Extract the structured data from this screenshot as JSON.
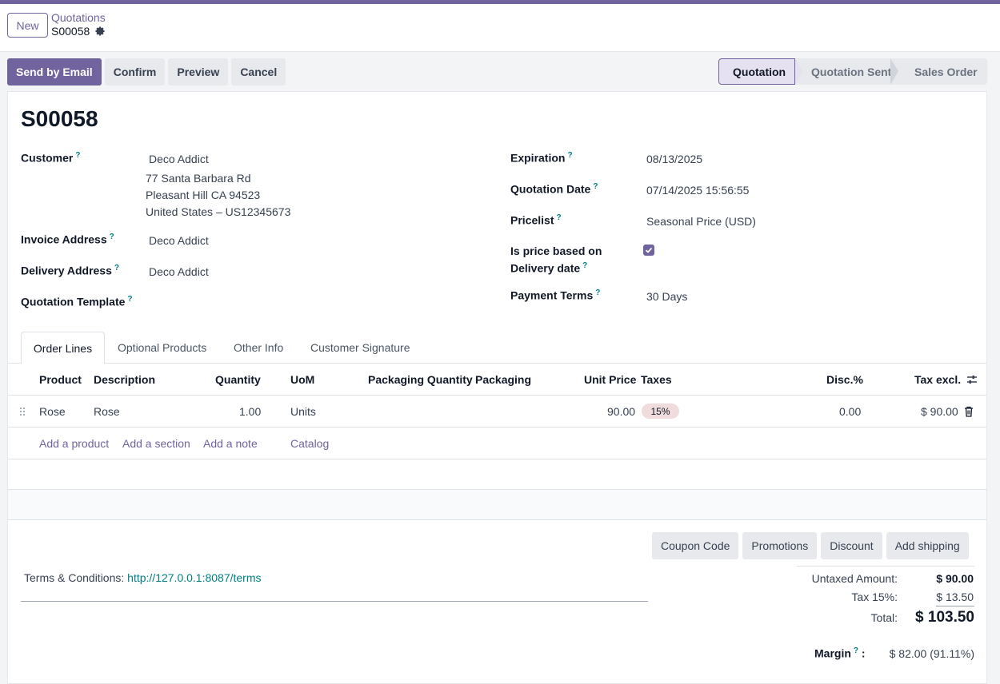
{
  "header": {
    "new_label": "New",
    "breadcrumb_parent": "Quotations",
    "breadcrumb_current": "S00058"
  },
  "actions": {
    "send_email": "Send by Email",
    "confirm": "Confirm",
    "preview": "Preview",
    "cancel": "Cancel"
  },
  "status": {
    "quotation": "Quotation",
    "quotation_sent": "Quotation Sent",
    "sales_order": "Sales Order",
    "active": "Quotation"
  },
  "form": {
    "title": "S00058",
    "customer_label": "Customer",
    "customer_name": "Deco Addict",
    "customer_address1": "77 Santa Barbara Rd",
    "customer_address2": "Pleasant Hill CA 94523",
    "customer_address3": "United States – US12345673",
    "invoice_label": "Invoice Address",
    "invoice_value": "Deco Addict",
    "delivery_label": "Delivery Address",
    "delivery_value": "Deco Addict",
    "template_label": "Quotation Template",
    "template_value": "",
    "expiration_label": "Expiration",
    "expiration_value": "08/13/2025",
    "qdate_label": "Quotation Date",
    "qdate_value": "07/14/2025 15:56:55",
    "pricelist_label": "Pricelist",
    "pricelist_value": "Seasonal Price (USD)",
    "price_delivery_label1": "Is price based on",
    "price_delivery_label2": "Delivery date",
    "price_delivery_checked": true,
    "payment_label": "Payment Terms",
    "payment_value": "30 Days",
    "help": "?"
  },
  "tabs": [
    "Order Lines",
    "Optional Products",
    "Other Info",
    "Customer Signature"
  ],
  "table": {
    "headers": {
      "product": "Product",
      "description": "Description",
      "quantity": "Quantity",
      "uom": "UoM",
      "packaging_qty": "Packaging Quantity",
      "packaging": "Packaging",
      "unit_price": "Unit Price",
      "taxes": "Taxes",
      "disc": "Disc.%",
      "tax_excl": "Tax excl."
    },
    "rows": [
      {
        "product": "Rose",
        "description": "Rose",
        "quantity": "1.00",
        "uom": "Units",
        "unit_price": "90.00",
        "tax": "15%",
        "disc": "0.00",
        "subtotal": "$ 90.00"
      }
    ],
    "add_product": "Add a product",
    "add_section": "Add a section",
    "add_note": "Add a note",
    "catalog": "Catalog"
  },
  "bottom_buttons": {
    "coupon": "Coupon Code",
    "promotions": "Promotions",
    "discount": "Discount",
    "shipping": "Add shipping"
  },
  "terms": {
    "label": "Terms & Conditions: ",
    "url": "http://127.0.0.1:8087/terms"
  },
  "totals": {
    "untaxed_label": "Untaxed Amount:",
    "untaxed_value": "$ 90.00",
    "tax_label": "Tax 15%:",
    "tax_value": "$ 13.50",
    "total_label": "Total:",
    "total_value": "$ 103.50",
    "margin_label": "Margin",
    "margin_colon": ":",
    "margin_value": "$ 82.00 (91.11%)"
  },
  "colors": {
    "brand": "#71639e",
    "help": "#017e84",
    "tax_badge": "#f0dcdc"
  }
}
